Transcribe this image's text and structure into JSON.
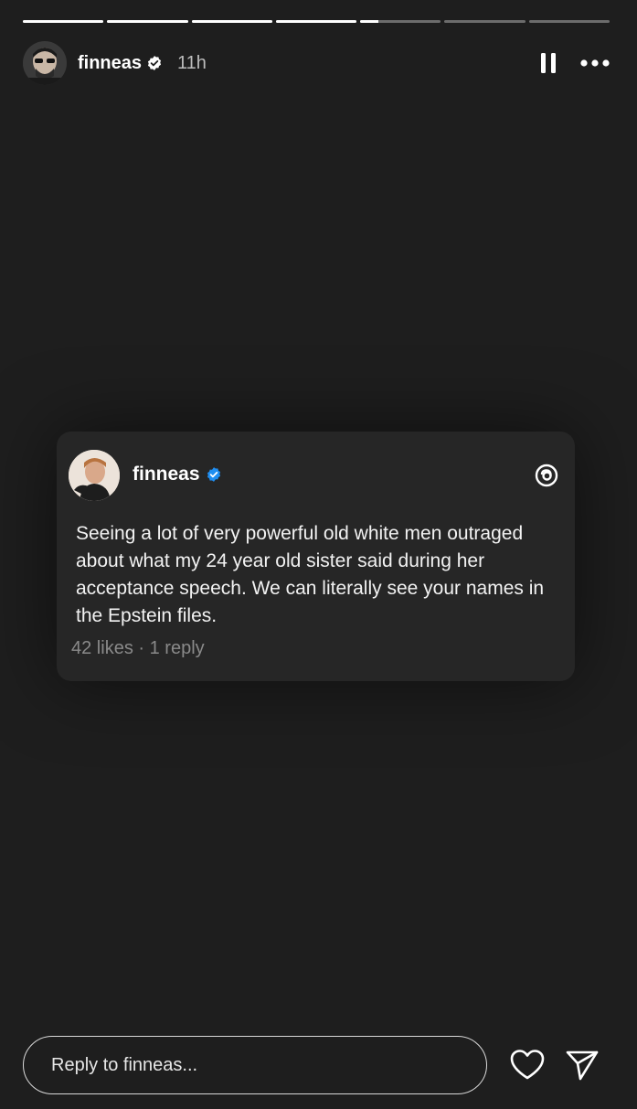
{
  "progress": [
    {
      "fill": 1
    },
    {
      "fill": 1
    },
    {
      "fill": 1
    },
    {
      "fill": 1
    },
    {
      "fill": 0.22
    },
    {
      "fill": 0
    },
    {
      "fill": 0
    }
  ],
  "header": {
    "username": "finneas",
    "time": "11h",
    "avatar_icon": "avatar-sunglasses",
    "verified_icon": "verified-badge-icon",
    "pause_icon": "pause-icon",
    "more_icon": "more-icon"
  },
  "card": {
    "username": "finneas",
    "text": "Seeing a lot of very powerful old white men outraged about what my 24 year old sister said during her acceptance speech. We can literally see your names in the Epstein files.",
    "likes": "42 likes",
    "separator": "·",
    "replies": "1 reply",
    "platform_icon": "threads-logo-icon",
    "verified_color": "#1f8ef1"
  },
  "footer": {
    "reply_placeholder": "Reply to finneas...",
    "like_icon": "heart-icon",
    "share_icon": "send-icon"
  },
  "colors": {
    "background": "#1e1e1e",
    "card": "#262626",
    "muted_text": "#8a8a8a"
  }
}
